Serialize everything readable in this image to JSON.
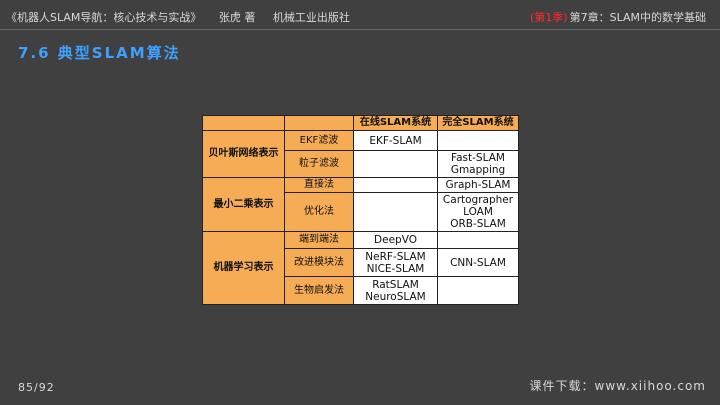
{
  "header": {
    "book_title": "《机器人SLAM导航：核心技术与实战》",
    "author": "张虎 著",
    "publisher": "机械工业出版社",
    "season": "(第1季)",
    "chapter": "第7章：SLAM中的数学基础"
  },
  "section_title": "7.6 典型SLAM算法",
  "table": {
    "col_headers": [
      "在线SLAM系统",
      "完全SLAM系统"
    ],
    "groups": [
      {
        "name": "贝叶斯网络表示",
        "methods": [
          {
            "method": "EKF滤波",
            "online": "EKF-SLAM",
            "full": ""
          },
          {
            "method": "粒子滤波",
            "online": "",
            "full": "Fast-SLAM\nGmapping"
          }
        ]
      },
      {
        "name": "最小二乘表示",
        "methods": [
          {
            "method": "直接法",
            "online": "",
            "full": "Graph-SLAM"
          },
          {
            "method": "优化法",
            "online": "",
            "full": "Cartographer\nLOAM\nORB-SLAM"
          }
        ]
      },
      {
        "name": "机器学习表示",
        "methods": [
          {
            "method": "端到端法",
            "online": "DeepVO",
            "full": ""
          },
          {
            "method": "改进模块法",
            "online": "NeRF-SLAM\nNICE-SLAM",
            "full": "CNN-SLAM"
          },
          {
            "method": "生物启发法",
            "online": "RatSLAM\nNeuroSLAM",
            "full": ""
          }
        ]
      }
    ]
  },
  "footer": {
    "page": "85/92",
    "download": "课件下载：www.xiihoo.com"
  },
  "colors": {
    "background": "#404040",
    "title_blue": "#3ea0ff",
    "season_red": "#ff2a2a",
    "table_orange": "#f6ac55"
  }
}
